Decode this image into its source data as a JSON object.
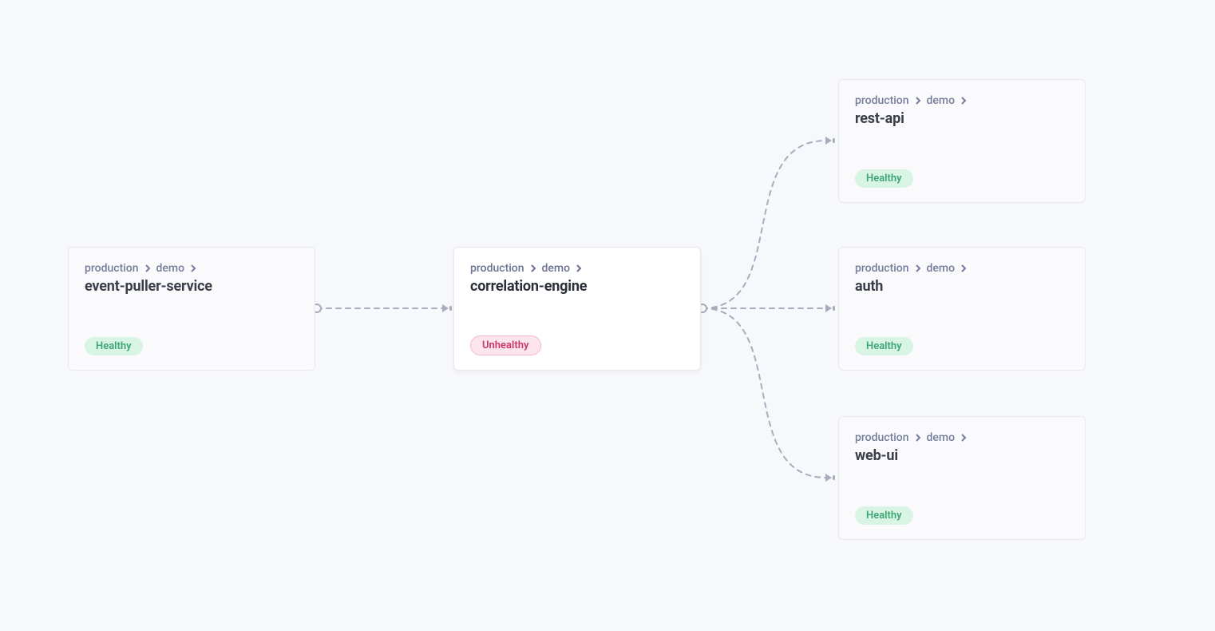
{
  "nodes": {
    "event_puller": {
      "breadcrumb": [
        "production",
        "demo"
      ],
      "title": "event-puller-service",
      "status_label": "Healthy",
      "status": "healthy"
    },
    "correlation_engine": {
      "breadcrumb": [
        "production",
        "demo"
      ],
      "title": "correlation-engine",
      "status_label": "Unhealthy",
      "status": "unhealthy"
    },
    "rest_api": {
      "breadcrumb": [
        "production",
        "demo"
      ],
      "title": "rest-api",
      "status_label": "Healthy",
      "status": "healthy"
    },
    "auth": {
      "breadcrumb": [
        "production",
        "demo"
      ],
      "title": "auth",
      "status_label": "Healthy",
      "status": "healthy"
    },
    "web_ui": {
      "breadcrumb": [
        "production",
        "demo"
      ],
      "title": "web-ui",
      "status_label": "Healthy",
      "status": "healthy"
    }
  },
  "colors": {
    "background": "#f7f8fc",
    "card_bg": "#ffffff",
    "card_dim_bg": "#fbfbfe",
    "border": "#e6e8ef",
    "breadcrumb": "#6b7393",
    "title": "#2a2f3a",
    "healthy_bg": "#d6f4e3",
    "healthy_fg": "#2f9e69",
    "unhealthy_bg": "#fde5ee",
    "unhealthy_fg": "#c7386a",
    "connector": "#a7adbd"
  }
}
